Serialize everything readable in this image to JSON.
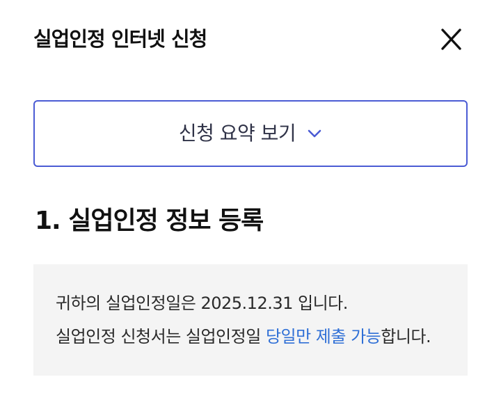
{
  "header": {
    "title": "실업인정 인터넷 신청",
    "close_icon": "close-icon"
  },
  "summary": {
    "label": "신청 요약 보기",
    "icon": "chevron-down-icon",
    "accent_color": "#4a5bd4"
  },
  "section": {
    "title": "1. 실업인정 정보 등록"
  },
  "notice": {
    "line1": "귀하의 실업인정일은 2025.12.31 입니다.",
    "line2_prefix": "실업인정 신청서는 실업인정일 ",
    "line2_highlight": "당일만 제출 가능",
    "line2_suffix": "합니다.",
    "highlight_color": "#2f6fd6",
    "background": "#f4f4f4"
  }
}
